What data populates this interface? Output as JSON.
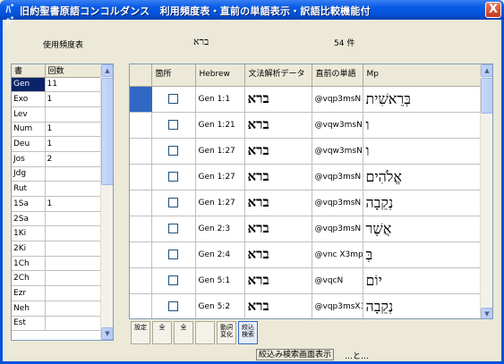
{
  "window": {
    "title": "旧約聖書原語コンコルダンス　利用頻度表・直前の単語表示・訳語比較機能付",
    "title_icon": "ﾊﾞﾊﾞ",
    "close_label": "X"
  },
  "header": {
    "freq_label": "使用頻度表",
    "word": "ברא",
    "count": "54 件"
  },
  "left_grid": {
    "columns": [
      "書",
      "回数"
    ],
    "rows": [
      {
        "book": "Gen",
        "count": "11",
        "selected": true
      },
      {
        "book": "Exo",
        "count": "1"
      },
      {
        "book": "Lev",
        "count": ""
      },
      {
        "book": "Num",
        "count": "1"
      },
      {
        "book": "Deu",
        "count": "1"
      },
      {
        "book": "Jos",
        "count": "2"
      },
      {
        "book": "Jdg",
        "count": ""
      },
      {
        "book": "Rut",
        "count": ""
      },
      {
        "book": "1Sa",
        "count": "1"
      },
      {
        "book": "2Sa",
        "count": ""
      },
      {
        "book": "1Ki",
        "count": ""
      },
      {
        "book": "2Ki",
        "count": ""
      },
      {
        "book": "1Ch",
        "count": ""
      },
      {
        "book": "2Ch",
        "count": ""
      },
      {
        "book": "Ezr",
        "count": ""
      },
      {
        "book": "Neh",
        "count": ""
      },
      {
        "book": "Est",
        "count": ""
      }
    ]
  },
  "right_grid": {
    "columns": [
      "箇所",
      "Hebrew",
      "文法解析データ",
      "直前の単語",
      "Mp"
    ],
    "rows": [
      {
        "ref": "Gen 1:1",
        "hebrew": "ברא",
        "parse": "@vqp3msN",
        "prev": "בְּרֵאשִׁית",
        "mp": "@ncfsN"
      },
      {
        "ref": "Gen 1:21",
        "hebrew": "ברא",
        "parse": "@vqw3msN",
        "prev": "ו",
        "mp": "@PcN"
      },
      {
        "ref": "Gen 1:27",
        "hebrew": "ברא",
        "parse": "@vqw3msN",
        "prev": "ו",
        "mp": "@PcN"
      },
      {
        "ref": "Gen 1:27",
        "hebrew": "ברא",
        "parse": "@vqp3msN",
        "prev": "אֱלֹהִים",
        "mp": "@ncmpN"
      },
      {
        "ref": "Gen 1:27",
        "hebrew": "ברא",
        "parse": "@vqp3msN",
        "prev": "נְקֵבָה",
        "mp": "@ncfsN"
      },
      {
        "ref": "Gen 2:3",
        "hebrew": "ברא",
        "parse": "@vqp3msN",
        "prev": "אֲשֶׁר",
        "mp": "@PrN"
      },
      {
        "ref": "Gen 2:4",
        "hebrew": "ברא",
        "parse": "@vnc X3mpN",
        "prev": "בְּ",
        "mp": "@PpN"
      },
      {
        "ref": "Gen 5:1",
        "hebrew": "ברא",
        "parse": "@vqcN",
        "prev": "יוֹם",
        "mp": "@ncmsN"
      },
      {
        "ref": "Gen 5:2",
        "hebrew": "ברא",
        "parse": "@vqp3msX3mpN",
        "prev": "נְקֵבָה",
        "mp": "@ncfsN"
      }
    ]
  },
  "toolbar": {
    "buttons": [
      {
        "label": "設定",
        "icon": "settings-icon"
      },
      {
        "label": "全",
        "icon": "select-all-icon"
      },
      {
        "label": "全",
        "icon": "check-all-icon"
      },
      {
        "label": "",
        "icon": "copy-icon"
      },
      {
        "label": "動詞変化",
        "icon": "verb-conjugation-icon"
      },
      {
        "label": "絞込検索",
        "icon": "filter-search-icon"
      }
    ]
  },
  "status": {
    "filter_button": "絞込み検索画面表示",
    "text": "…と…"
  }
}
